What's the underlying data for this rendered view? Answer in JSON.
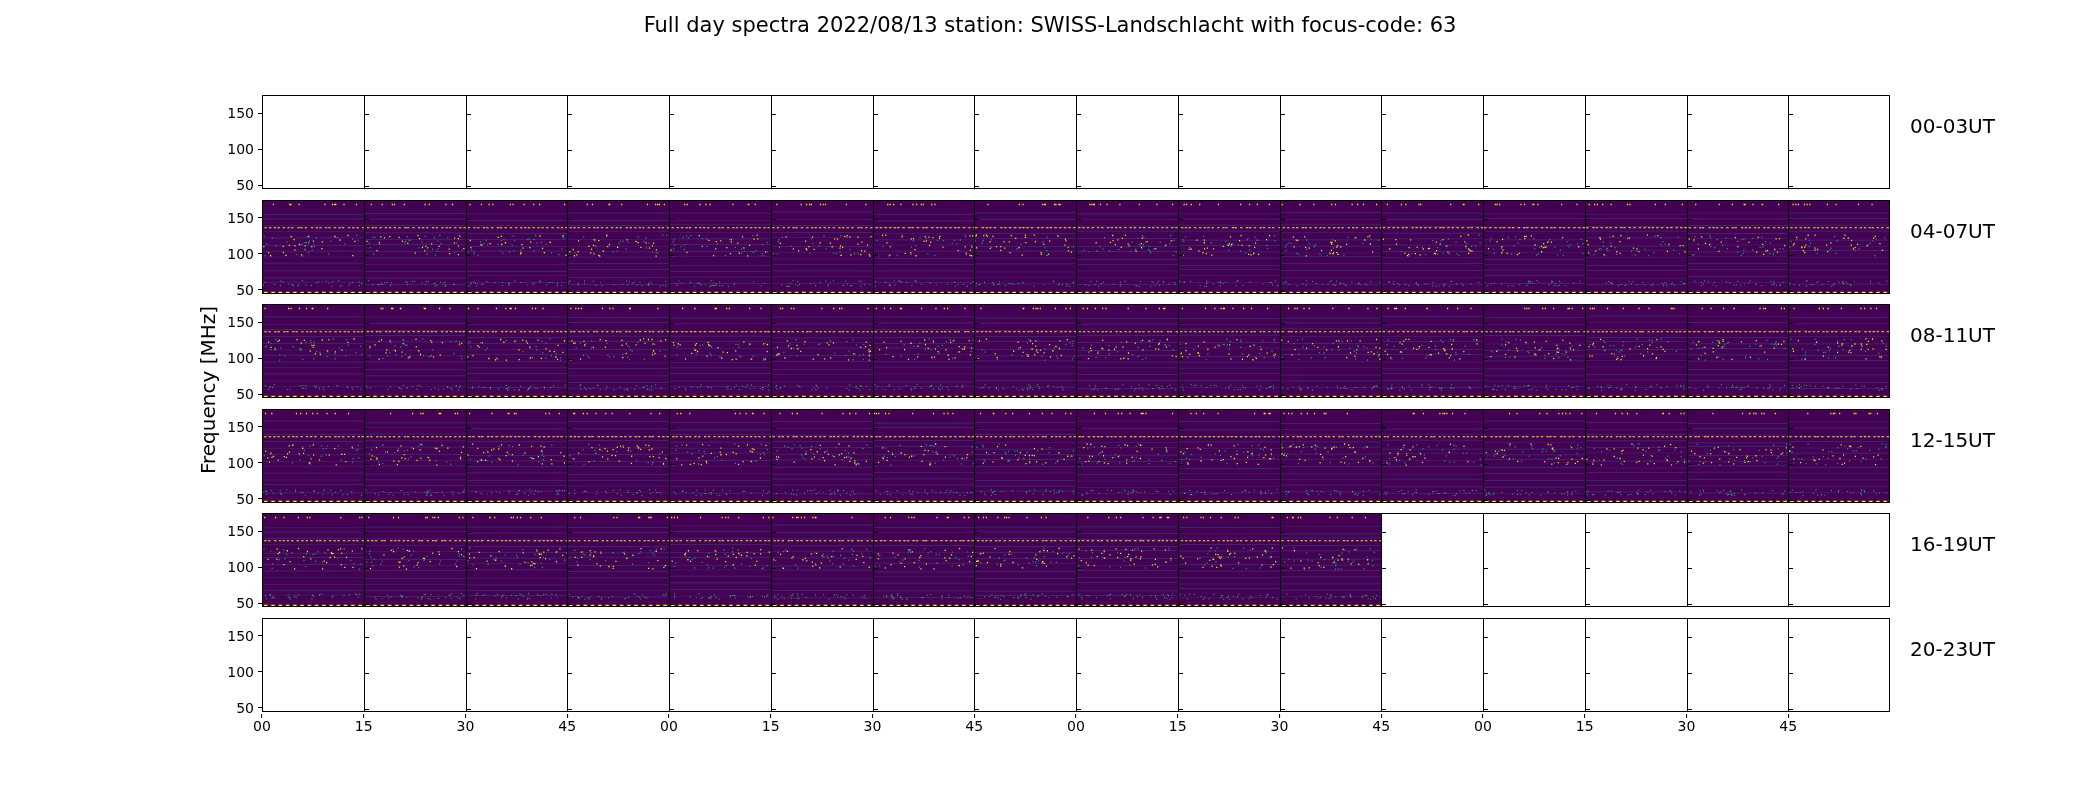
{
  "title": "Full day spectra 2022/08/13 station: SWISS-Landschlacht with focus-code: 63",
  "ylabel": "Frequency [MHz]",
  "rows": [
    {
      "label": "00-03UT",
      "yticks": [
        "150",
        "100",
        "50"
      ],
      "panels": [
        {
          "has_data": false
        },
        {
          "has_data": false
        },
        {
          "has_data": false
        },
        {
          "has_data": false
        },
        {
          "has_data": false
        },
        {
          "has_data": false
        },
        {
          "has_data": false
        },
        {
          "has_data": false
        },
        {
          "has_data": false
        },
        {
          "has_data": false
        },
        {
          "has_data": false
        },
        {
          "has_data": false
        },
        {
          "has_data": false
        },
        {
          "has_data": false
        },
        {
          "has_data": false
        },
        {
          "has_data": false
        }
      ]
    },
    {
      "label": "04-07UT",
      "yticks": [
        "150",
        "100",
        "50"
      ],
      "panels": [
        {
          "has_data": true
        },
        {
          "has_data": true
        },
        {
          "has_data": true
        },
        {
          "has_data": true
        },
        {
          "has_data": true
        },
        {
          "has_data": true
        },
        {
          "has_data": true
        },
        {
          "has_data": true
        },
        {
          "has_data": true
        },
        {
          "has_data": true
        },
        {
          "has_data": true
        },
        {
          "has_data": true
        },
        {
          "has_data": true
        },
        {
          "has_data": true
        },
        {
          "has_data": true
        },
        {
          "has_data": true
        }
      ]
    },
    {
      "label": "08-11UT",
      "yticks": [
        "150",
        "100",
        "50"
      ],
      "panels": [
        {
          "has_data": true
        },
        {
          "has_data": true
        },
        {
          "has_data": true
        },
        {
          "has_data": true
        },
        {
          "has_data": true
        },
        {
          "has_data": true
        },
        {
          "has_data": true
        },
        {
          "has_data": true
        },
        {
          "has_data": true
        },
        {
          "has_data": true
        },
        {
          "has_data": true
        },
        {
          "has_data": true
        },
        {
          "has_data": true
        },
        {
          "has_data": true
        },
        {
          "has_data": true
        },
        {
          "has_data": true
        }
      ]
    },
    {
      "label": "12-15UT",
      "yticks": [
        "150",
        "100",
        "50"
      ],
      "panels": [
        {
          "has_data": true
        },
        {
          "has_data": true
        },
        {
          "has_data": true
        },
        {
          "has_data": true
        },
        {
          "has_data": true
        },
        {
          "has_data": true
        },
        {
          "has_data": true
        },
        {
          "has_data": true
        },
        {
          "has_data": true
        },
        {
          "has_data": true
        },
        {
          "has_data": true
        },
        {
          "has_data": true
        },
        {
          "has_data": true
        },
        {
          "has_data": true
        },
        {
          "has_data": true
        },
        {
          "has_data": true
        }
      ]
    },
    {
      "label": "16-19UT",
      "yticks": [
        "150",
        "100",
        "50"
      ],
      "panels": [
        {
          "has_data": true
        },
        {
          "has_data": true
        },
        {
          "has_data": true
        },
        {
          "has_data": true
        },
        {
          "has_data": true
        },
        {
          "has_data": true
        },
        {
          "has_data": true
        },
        {
          "has_data": true
        },
        {
          "has_data": true
        },
        {
          "has_data": true
        },
        {
          "has_data": true
        },
        {
          "has_data": false
        },
        {
          "has_data": false
        },
        {
          "has_data": false
        },
        {
          "has_data": false
        },
        {
          "has_data": false
        }
      ]
    },
    {
      "label": "20-23UT",
      "yticks": [
        "150",
        "100",
        "50"
      ],
      "panels": [
        {
          "has_data": false
        },
        {
          "has_data": false
        },
        {
          "has_data": false
        },
        {
          "has_data": false
        },
        {
          "has_data": false
        },
        {
          "has_data": false
        },
        {
          "has_data": false
        },
        {
          "has_data": false
        },
        {
          "has_data": false
        },
        {
          "has_data": false
        },
        {
          "has_data": false
        },
        {
          "has_data": false
        },
        {
          "has_data": false
        },
        {
          "has_data": false
        },
        {
          "has_data": false
        },
        {
          "has_data": false
        }
      ]
    }
  ],
  "xticks": [
    "00",
    "15",
    "30",
    "45",
    "00",
    "15",
    "30",
    "45",
    "00",
    "15",
    "30",
    "45",
    "00",
    "15",
    "30",
    "45"
  ]
}
